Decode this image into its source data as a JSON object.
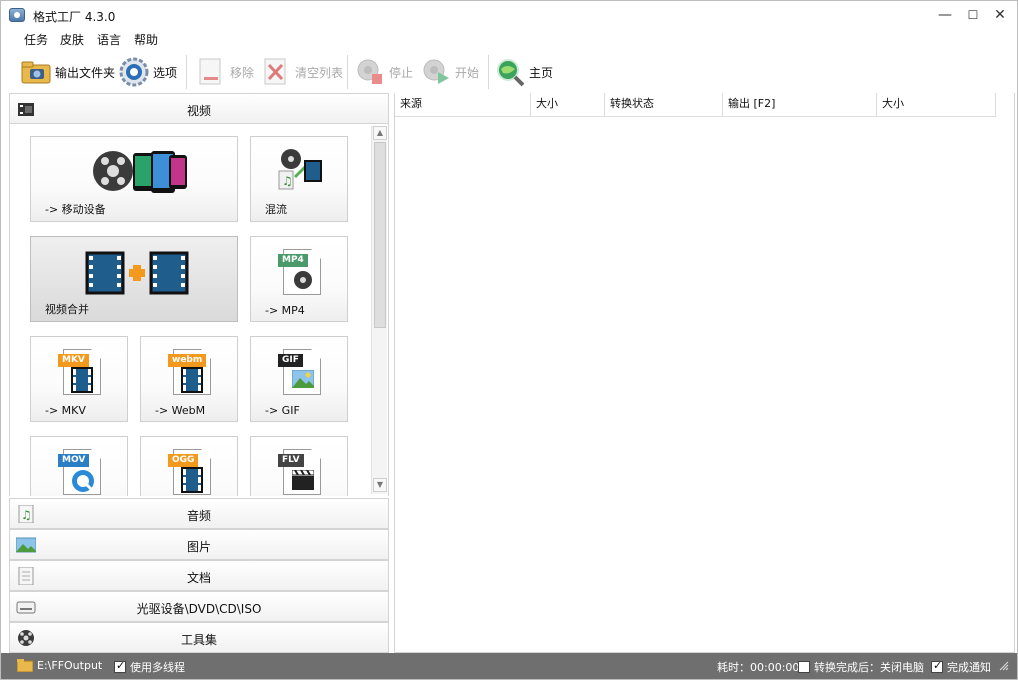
{
  "window": {
    "title": "格式工厂 4.3.0",
    "controls": {
      "minimize": "—",
      "maximize": "☐",
      "close": "✕"
    }
  },
  "menu": [
    "任务",
    "皮肤",
    "语言",
    "帮助"
  ],
  "toolbar": {
    "output_folder": "输出文件夹",
    "options": "选项",
    "remove": "移除",
    "clear_list": "清空列表",
    "stop": "停止",
    "start": "开始",
    "home": "主页"
  },
  "categories": {
    "video": "视频",
    "audio": "音频",
    "image": "图片",
    "document": "文档",
    "optical": "光驱设备\\DVD\\CD\\ISO",
    "tools": "工具集"
  },
  "tiles": {
    "mobile": "-> 移动设备",
    "mix": "混流",
    "merge": "视频合并",
    "mp4": "-> MP4",
    "mkv": "-> MKV",
    "webm": "-> WebM",
    "gif": "-> GIF"
  },
  "tags": {
    "mp4": "MP4",
    "mkv": "MKV",
    "webm": "webm",
    "gif": "GIF",
    "mov": "MOV",
    "ogg": "OGG",
    "flv": "FLV"
  },
  "columns": [
    "来源",
    "大小",
    "转换状态",
    "输出 [F2]",
    "大小"
  ],
  "status": {
    "output_path": "E:\\FFOutput",
    "multithread": "使用多线程",
    "elapsed": "耗时：00:00:00",
    "after_done": "转换完成后：关闭电脑",
    "notify": "完成通知"
  },
  "colors": {
    "statusbar": "#6f6f6f",
    "film": "#1f5d8c",
    "accent_orange": "#f39a1e",
    "mp4_tag": "#4a9a6b"
  }
}
